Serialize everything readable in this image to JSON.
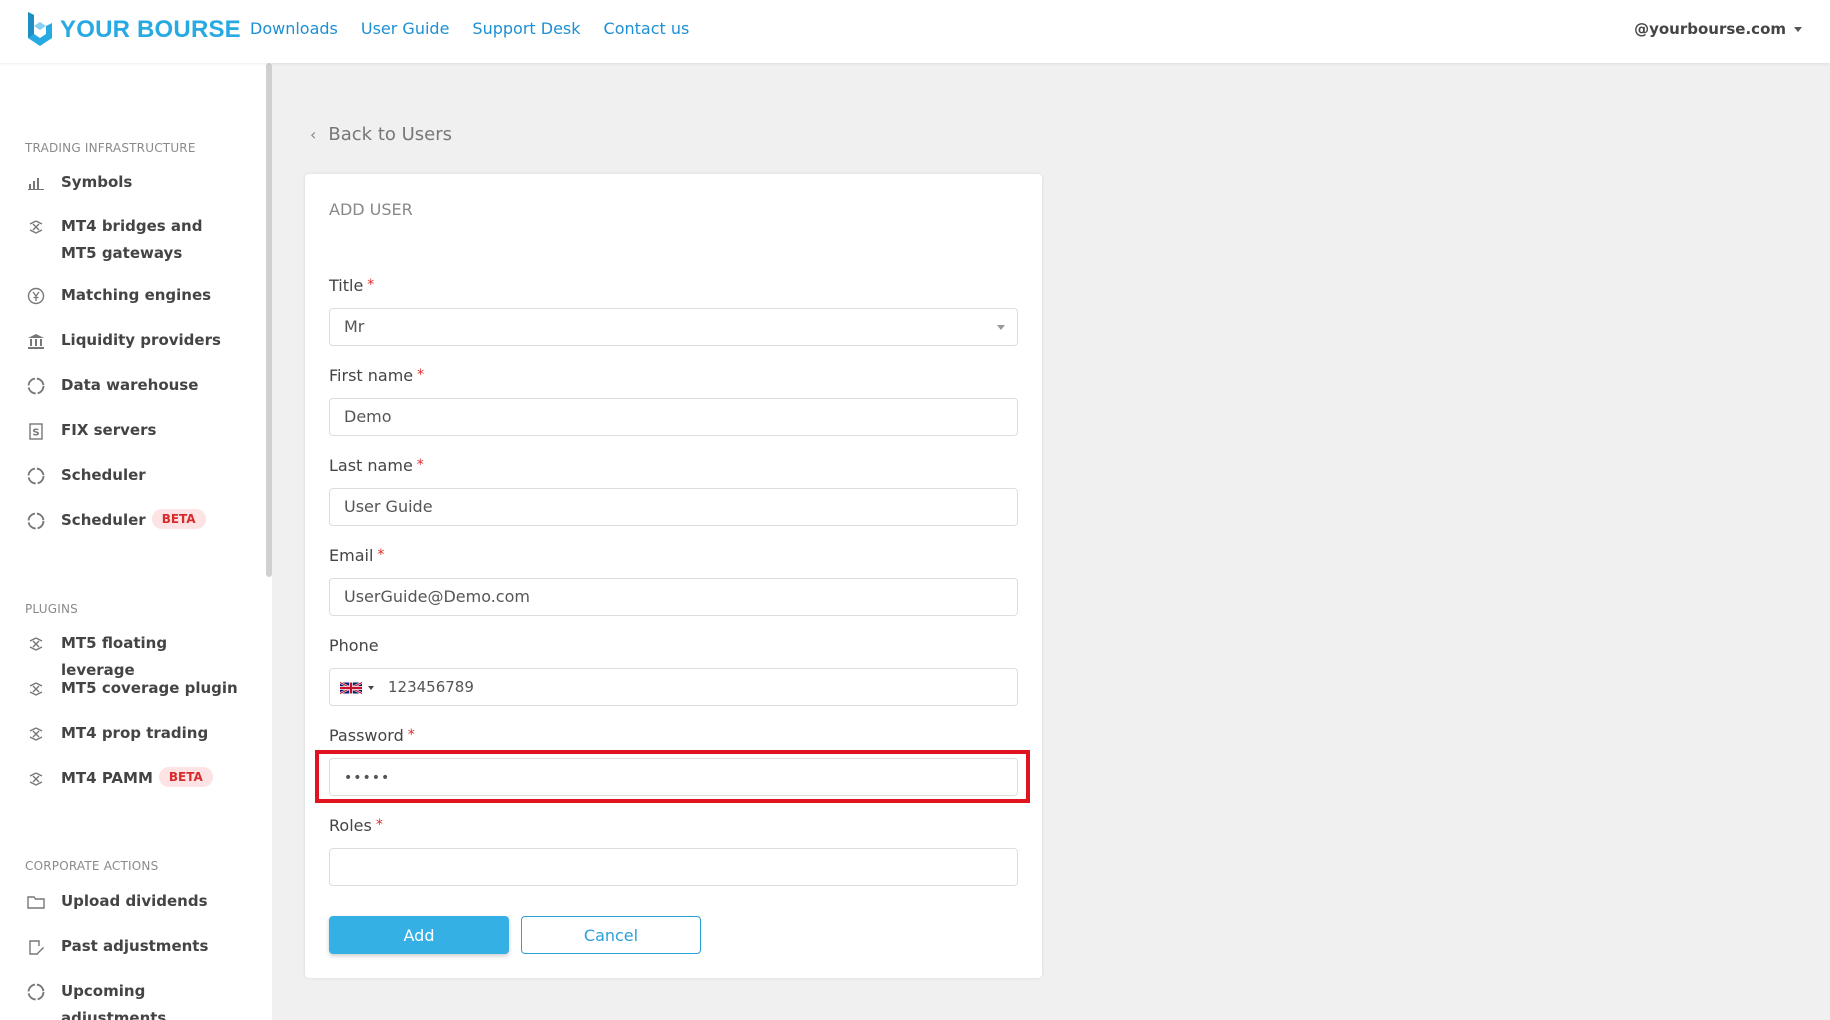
{
  "header": {
    "logo_text": "YOUR BOURSE",
    "nav": [
      "Downloads",
      "User Guide",
      "Support Desk",
      "Contact us"
    ],
    "account": "@yourbourse.com"
  },
  "sidebar": {
    "sections": [
      {
        "title": "TRADING INFRASTRUCTURE",
        "items": [
          {
            "label": "Symbols",
            "icon": "bar-chart-icon"
          },
          {
            "label": "MT4 bridges and MT5 gateways",
            "icon": "bridge-icon"
          },
          {
            "label": "Matching engines",
            "icon": "yen-circle-icon"
          },
          {
            "label": "Liquidity providers",
            "icon": "bank-icon"
          },
          {
            "label": "Data warehouse",
            "icon": "circle-icon"
          },
          {
            "label": "FIX servers",
            "icon": "document-s-icon"
          },
          {
            "label": "Scheduler",
            "icon": "circle-icon"
          },
          {
            "label": "Scheduler",
            "icon": "circle-icon",
            "badge": "BETA"
          }
        ]
      },
      {
        "title": "PLUGINS",
        "items": [
          {
            "label": "MT5 floating leverage",
            "icon": "bridge-icon"
          },
          {
            "label": "MT5 coverage plugin",
            "icon": "bridge-icon"
          },
          {
            "label": "MT4 prop trading",
            "icon": "bridge-icon"
          },
          {
            "label": "MT4 PAMM",
            "icon": "bridge-icon",
            "badge": "BETA"
          }
        ]
      },
      {
        "title": "CORPORATE ACTIONS",
        "items": [
          {
            "label": "Upload dividends",
            "icon": "folder-icon"
          },
          {
            "label": "Past adjustments",
            "icon": "edit-document-icon"
          },
          {
            "label": "Upcoming adjustments",
            "icon": "circle-icon"
          }
        ]
      }
    ]
  },
  "main": {
    "back_label": "Back to Users",
    "card_title": "ADD USER",
    "fields": {
      "title": {
        "label": "Title",
        "value": "Mr"
      },
      "first_name": {
        "label": "First name",
        "value": "Demo"
      },
      "last_name": {
        "label": "Last name",
        "value": "User Guide"
      },
      "email": {
        "label": "Email",
        "value": "UserGuide@Demo.com"
      },
      "phone": {
        "label": "Phone",
        "value": "123456789",
        "country_flag": "uk-flag-icon"
      },
      "password": {
        "label": "Password",
        "value": "•••••"
      },
      "roles": {
        "label": "Roles",
        "value": ""
      }
    },
    "required_marker": "*",
    "add_label": "Add",
    "cancel_label": "Cancel"
  },
  "colors": {
    "brand": "#27a9e1",
    "link": "#1d8fd4",
    "primary_button": "#35b0e5",
    "required": "#e02a2a",
    "highlight_box": "#e0141e"
  }
}
